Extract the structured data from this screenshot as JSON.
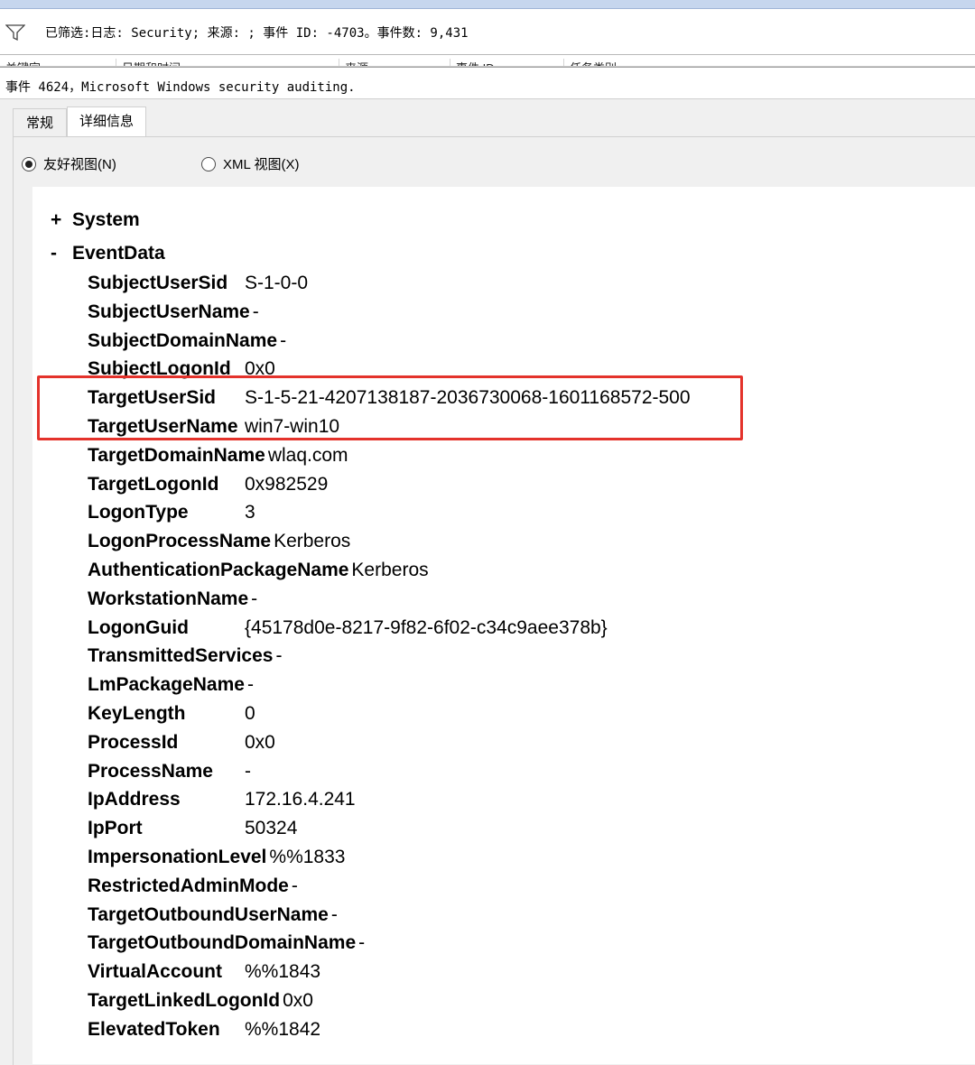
{
  "filter": {
    "text": "已筛选:日志: Security; 来源: ; 事件 ID: -4703。事件数: 9,431"
  },
  "columns": [
    "关键字",
    "日期和时间",
    "来源",
    "事件 ID",
    "任务类别"
  ],
  "event_title": "事件 4624，Microsoft Windows security auditing.",
  "tabs": [
    {
      "label": "常规",
      "selected": false
    },
    {
      "label": "详细信息",
      "selected": true
    }
  ],
  "views": {
    "friendly": {
      "label": "友好视图(N)",
      "selected": true
    },
    "xml": {
      "label": "XML 视图(X)",
      "selected": false
    }
  },
  "tree": {
    "system": {
      "symbol": "+",
      "label": "System"
    },
    "eventdata": {
      "symbol": "-",
      "label": "EventData"
    }
  },
  "event_data": [
    {
      "key": "SubjectUserSid",
      "value": "S-1-0-0"
    },
    {
      "key": "SubjectUserName",
      "value": "-"
    },
    {
      "key": "SubjectDomainName",
      "value": "-"
    },
    {
      "key": "SubjectLogonId",
      "value": "0x0"
    },
    {
      "key": "TargetUserSid",
      "value": "S-1-5-21-4207138187-2036730068-1601168572-500"
    },
    {
      "key": "TargetUserName",
      "value": "win7-win10"
    },
    {
      "key": "TargetDomainName",
      "value": "wlaq.com"
    },
    {
      "key": "TargetLogonId",
      "value": "0x982529"
    },
    {
      "key": "LogonType",
      "value": "3"
    },
    {
      "key": "LogonProcessName",
      "value": "Kerberos"
    },
    {
      "key": "AuthenticationPackageName",
      "value": "Kerberos"
    },
    {
      "key": "WorkstationName",
      "value": "-"
    },
    {
      "key": "LogonGuid",
      "value": "{45178d0e-8217-9f82-6f02-c34c9aee378b}"
    },
    {
      "key": "TransmittedServices",
      "value": "-"
    },
    {
      "key": "LmPackageName",
      "value": "-"
    },
    {
      "key": "KeyLength",
      "value": "0"
    },
    {
      "key": "ProcessId",
      "value": "0x0"
    },
    {
      "key": "ProcessName",
      "value": "-"
    },
    {
      "key": "IpAddress",
      "value": "172.16.4.241"
    },
    {
      "key": "IpPort",
      "value": "50324"
    },
    {
      "key": "ImpersonationLevel",
      "value": "%%1833"
    },
    {
      "key": "RestrictedAdminMode",
      "value": "-"
    },
    {
      "key": "TargetOutboundUserName",
      "value": "-"
    },
    {
      "key": "TargetOutboundDomainName",
      "value": "-"
    },
    {
      "key": "VirtualAccount",
      "value": "%%1843"
    },
    {
      "key": "TargetLinkedLogonId",
      "value": "0x0"
    },
    {
      "key": "ElevatedToken",
      "value": "%%1842"
    }
  ],
  "colors": {
    "highlight": "#e4322b"
  }
}
